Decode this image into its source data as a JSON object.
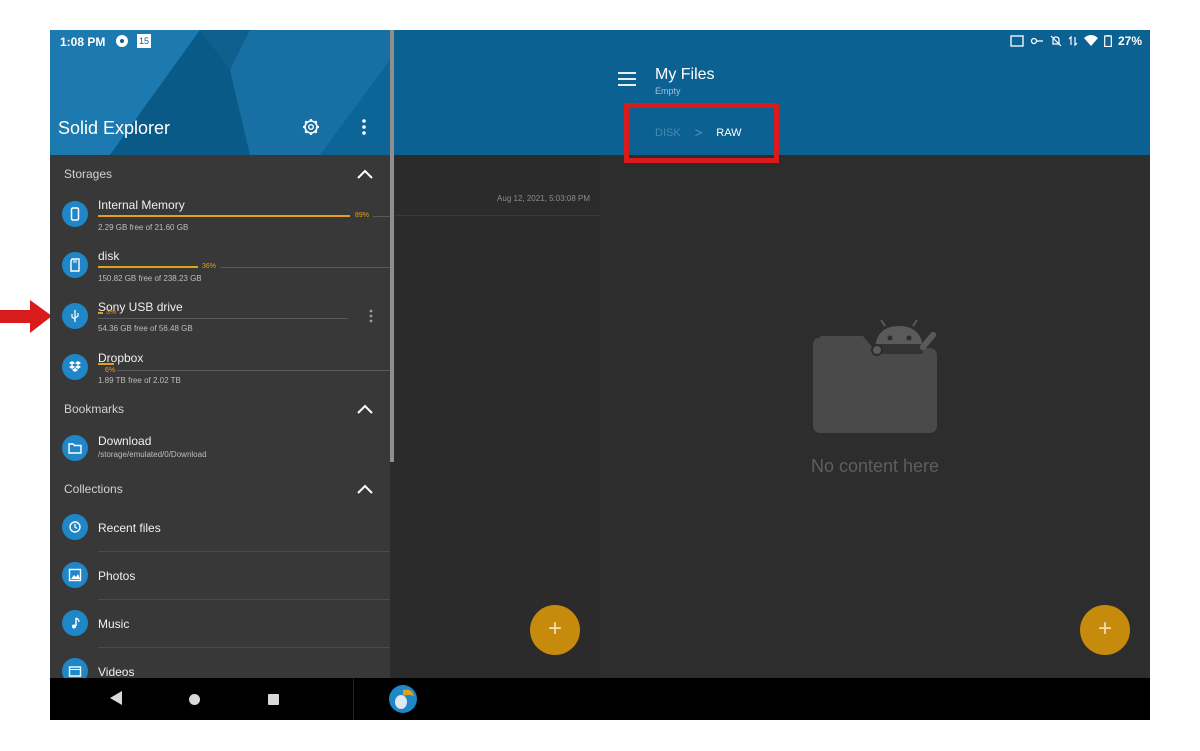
{
  "status_bar": {
    "time": "1:08 PM",
    "calendar_day": "15",
    "battery": "27%"
  },
  "drawer": {
    "title": "Solid Explorer",
    "sections": {
      "storages": "Storages",
      "bookmarks": "Bookmarks",
      "collections": "Collections"
    },
    "storages": [
      {
        "name": "Internal Memory",
        "detail": "2.29 GB free of 21.60 GB",
        "used_label": "89%",
        "used_fraction": 0.89,
        "icon": "phone-icon"
      },
      {
        "name": "disk",
        "detail": "150.82 GB free of 238.23 GB",
        "used_label": "36%",
        "used_fraction": 0.36,
        "icon": "sd-card-icon"
      },
      {
        "name": "Sony USB drive",
        "detail": "54.36 GB free of 56.48 GB",
        "used_label": "3%",
        "used_fraction": 0.03,
        "icon": "usb-icon"
      },
      {
        "name": "Dropbox",
        "detail": "1.89 TB free of 2.02 TB",
        "used_label": "6%",
        "used_fraction": 0.06,
        "icon": "dropbox-icon"
      }
    ],
    "bookmarks": [
      {
        "name": "Download",
        "path": "/storage/emulated/0/Download",
        "icon": "folder-icon"
      }
    ],
    "collections": [
      {
        "name": "Recent files",
        "icon": "history-icon"
      },
      {
        "name": "Photos",
        "icon": "photo-icon"
      },
      {
        "name": "Music",
        "icon": "music-icon"
      },
      {
        "name": "Videos",
        "icon": "video-icon"
      }
    ]
  },
  "middle_pane": {
    "timestamp": "Aug 12, 2021, 5:03:08 PM"
  },
  "right_pane": {
    "title": "My Files",
    "subtitle": "Empty",
    "breadcrumbs": [
      "DISK",
      "RAW"
    ],
    "breadcrumb_separator": ">",
    "empty_message": "No content here"
  },
  "fab": {
    "label": "+"
  },
  "colors": {
    "header_blue": "#0b6191",
    "accent_orange": "#e0a01c",
    "fab_orange": "#c68a0c",
    "icon_blue": "#1f86c8",
    "annotation_red": "#d81b1b"
  }
}
